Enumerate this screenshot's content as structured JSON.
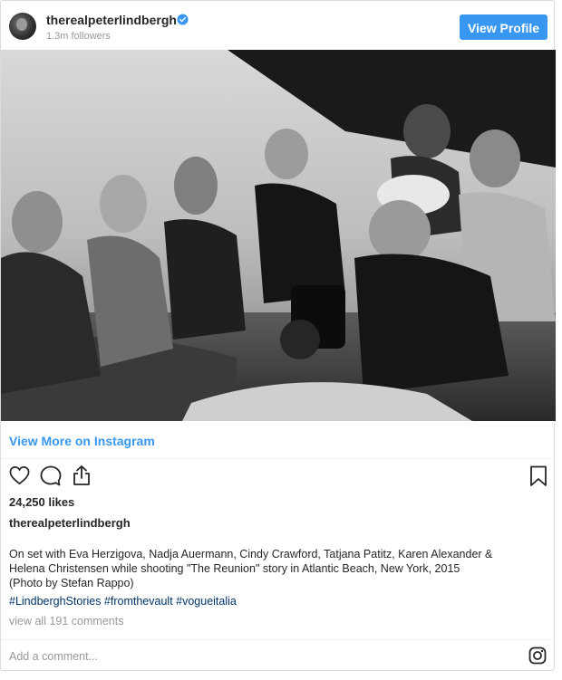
{
  "header": {
    "username": "therealpeterlindbergh",
    "followers": "1.3m followers",
    "view_profile_label": "View Profile"
  },
  "post": {
    "view_more_label": "View More on Instagram",
    "likes": "24,250 likes",
    "caption_user": "therealpeterlindbergh",
    "caption_line1": "On set with Eva Herzigova, Nadja Auermann, Cindy Crawford, Tatjana Patitz, Karen Alexander &",
    "caption_line2": "Helena Christensen while shooting \"The Reunion\" story in Atlantic Beach, New York, 2015",
    "caption_line3": "(Photo by Stefan Rappo)",
    "hashtags": "#LindberghStories #fromthevault #vogueitalia",
    "comments_link": "view all 191 comments",
    "comment_placeholder": "Add a comment..."
  },
  "icons": {
    "avatar": "avatar-photo",
    "verified": "verified-badge-icon",
    "like": "heart-icon",
    "comment": "comment-bubble-icon",
    "share": "share-icon",
    "save": "bookmark-icon",
    "instagram": "instagram-logo-icon"
  },
  "colors": {
    "accent": "#3897f0",
    "hashtag": "#003569",
    "muted": "#999999",
    "border": "#dbdbdb"
  }
}
